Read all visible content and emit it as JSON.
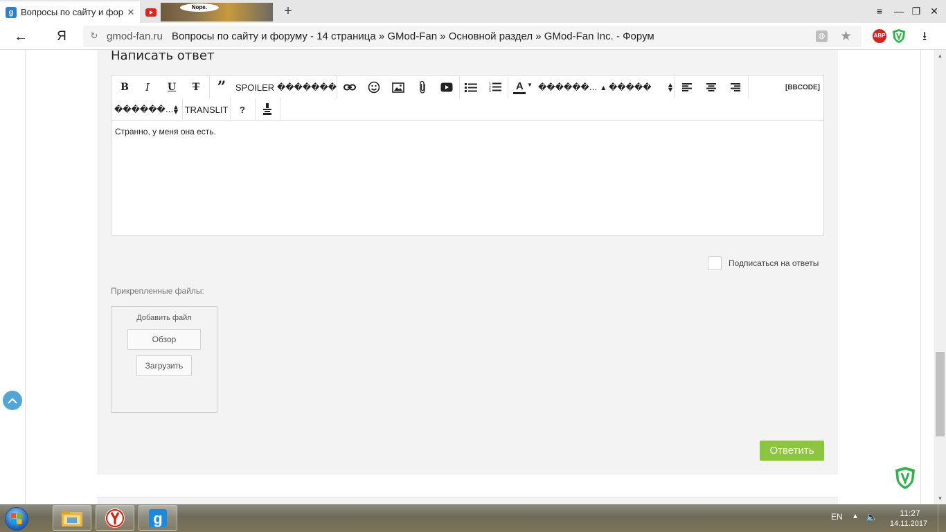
{
  "browser": {
    "tabs": [
      {
        "title": "Вопросы по сайту и фор",
        "favicon": "gmod-favicon-icon",
        "active": true
      },
      {
        "title": "",
        "favicon": "youtube-icon",
        "thumbnail_text": "Nope."
      }
    ],
    "new_tab": "+",
    "window_controls": {
      "menu": "≡",
      "minimize": "—",
      "restore": "❐",
      "close": "✕"
    },
    "address": {
      "domain": "gmod-fan.ru",
      "page_title": "Вопросы по сайту и форуму - 14 страница » GMod-Fan » Основной раздел » GMod-Fan Inc. - Форум"
    },
    "back": "←",
    "yandex": "Я",
    "extensions": {
      "adblock": "ABP"
    }
  },
  "page": {
    "heading": "Написать ответ",
    "toolbar": {
      "bold": "B",
      "italic": "I",
      "underline": "U",
      "strike": "T",
      "quote": "”",
      "spoiler": "SPOILER",
      "garbled1": "�������",
      "font_select": "������...",
      "size_select": "�����",
      "bbcode": "[BBCODE]",
      "style_select": "������...",
      "translit": "TRANSLIT",
      "help": "?",
      "color_letter": "A"
    },
    "editor_text": "Странно, у меня она есть.",
    "subscribe_label": "Подписаться на ответы",
    "attachments": {
      "label": "Прикрепленные файлы:",
      "add_file": "Добавить файл",
      "browse": "Обзор",
      "upload": "Загрузить"
    },
    "submit": "Ответить"
  },
  "taskbar": {
    "language": "EN",
    "time": "11:27",
    "date": "14.11.2017",
    "apps": [
      "explorer-icon",
      "yandex-browser-icon",
      "gmod-app-icon"
    ]
  },
  "colors": {
    "accent_green": "#8cc63f",
    "scroll_top_blue": "#4ea7d8",
    "shield_green": "#2db34a"
  }
}
